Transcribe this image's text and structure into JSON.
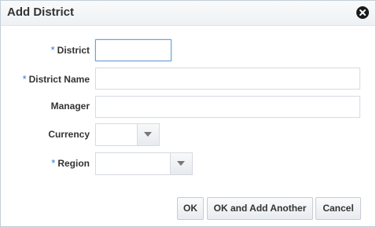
{
  "dialog": {
    "title": "Add District",
    "close_icon": "close-circle-icon"
  },
  "form": {
    "required_marker": "*",
    "district": {
      "label": "District",
      "value": "",
      "required": true
    },
    "district_name": {
      "label": "District Name",
      "value": "",
      "required": true
    },
    "manager": {
      "label": "Manager",
      "value": "",
      "required": false
    },
    "currency": {
      "label": "Currency",
      "value": "",
      "required": false,
      "dropdown_icon": "chevron-down-icon"
    },
    "region": {
      "label": "Region",
      "value": "",
      "required": true,
      "dropdown_icon": "chevron-down-icon"
    }
  },
  "buttons": {
    "ok": "OK",
    "ok_add_another": "OK and Add Another",
    "cancel": "Cancel"
  },
  "colors": {
    "required_marker": "#2f7ad6",
    "focus_border": "#6fa0d8"
  }
}
